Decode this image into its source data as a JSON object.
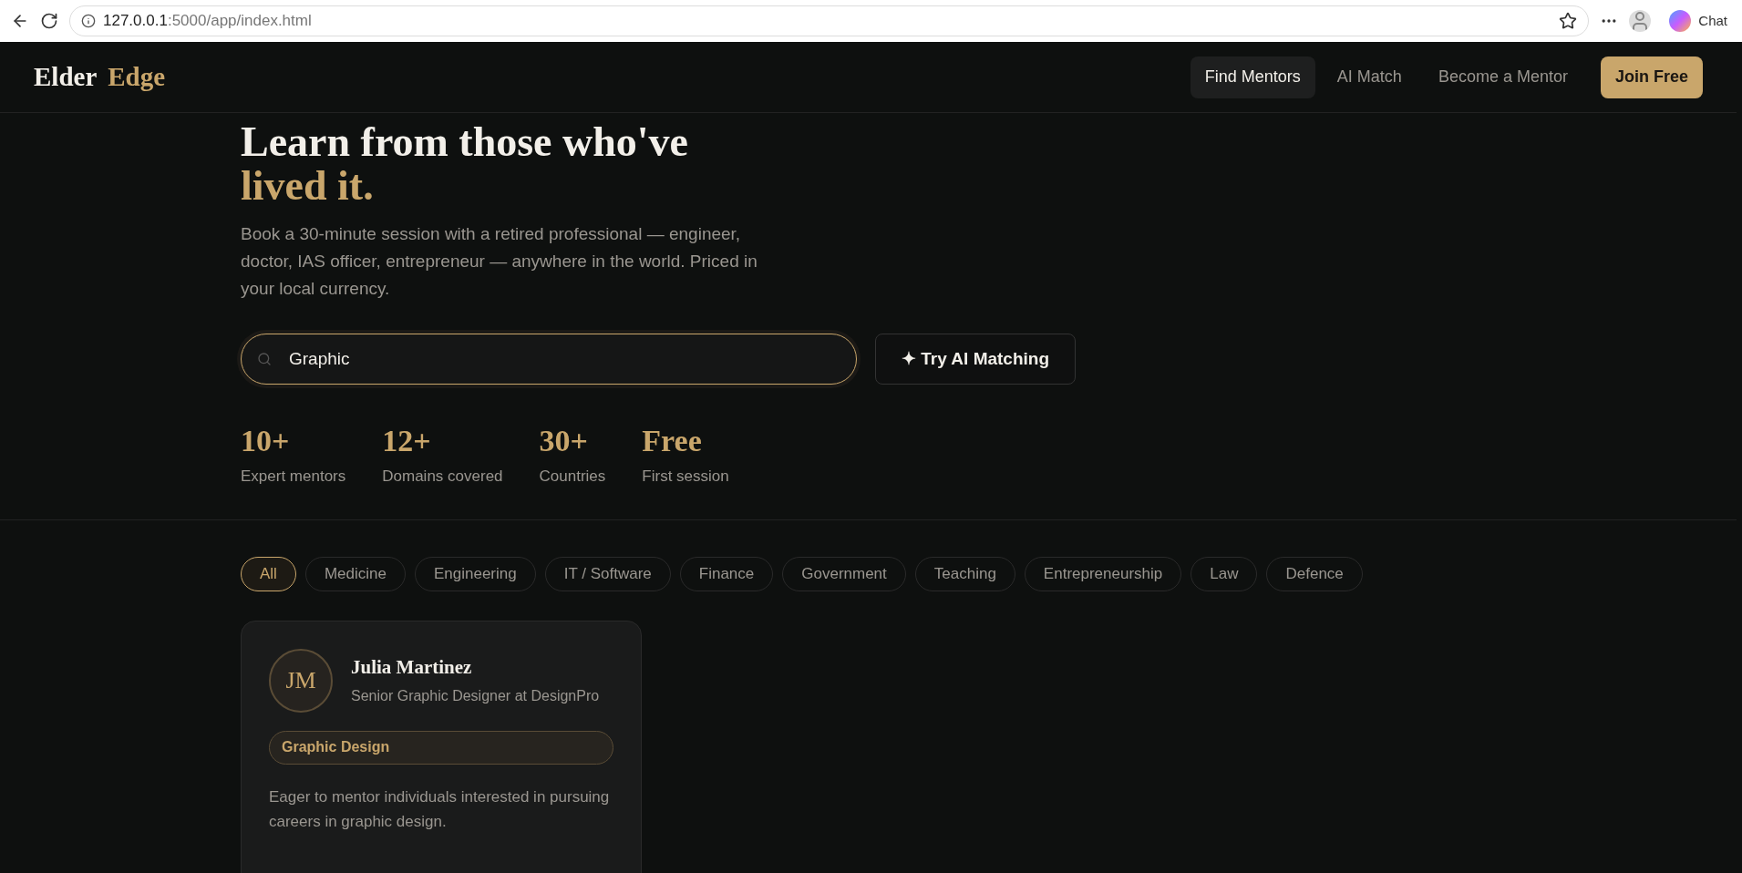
{
  "browser": {
    "url_host": "127.0.0.1",
    "url_rest": ":5000/app/index.html",
    "chat_label": "Chat"
  },
  "header": {
    "logo_first": "Elder",
    "logo_second": "Edge",
    "nav": [
      {
        "label": "Find Mentors",
        "selected": true
      },
      {
        "label": "AI Match",
        "selected": false
      },
      {
        "label": "Become a Mentor",
        "selected": false
      }
    ],
    "cta": "Join Free"
  },
  "hero": {
    "title_line": "Learn from those who've",
    "title_accent": "lived it.",
    "description": "Book a 30-minute session with a retired professional — engineer, doctor, IAS officer, entrepreneur — anywhere in the world. Priced in your local currency.",
    "search": {
      "value": "Graphic",
      "focused": true
    },
    "ai_button": "✦ Try AI Matching"
  },
  "stats": [
    {
      "value": "10+",
      "label": "Expert mentors"
    },
    {
      "value": "12+",
      "label": "Domains covered"
    },
    {
      "value": "30+",
      "label": "Countries"
    },
    {
      "value": "Free",
      "label": "First session"
    }
  ],
  "filters": [
    {
      "label": "All",
      "selected": true
    },
    {
      "label": "Medicine",
      "selected": false
    },
    {
      "label": "Engineering",
      "selected": false
    },
    {
      "label": "IT / Software",
      "selected": false
    },
    {
      "label": "Finance",
      "selected": false
    },
    {
      "label": "Government",
      "selected": false
    },
    {
      "label": "Teaching",
      "selected": false
    },
    {
      "label": "Entrepreneurship",
      "selected": false
    },
    {
      "label": "Law",
      "selected": false
    },
    {
      "label": "Defence",
      "selected": false
    }
  ],
  "mentors": [
    {
      "initials": "JM",
      "name": "Julia Martinez",
      "role": "Senior Graphic Designer at DesignPro",
      "domain": "Graphic Design",
      "bio": "Eager to mentor individuals interested in pursuing careers in graphic design."
    }
  ]
}
